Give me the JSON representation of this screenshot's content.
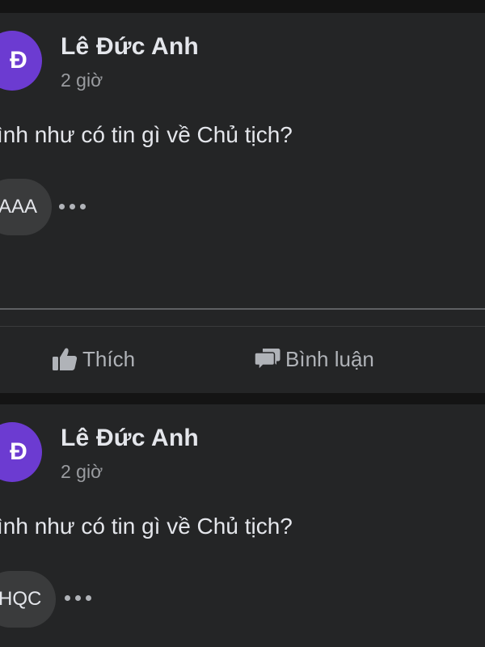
{
  "posts": [
    {
      "avatar_letter": "Đ",
      "avatar_color": "#6c3bd1",
      "author": "Lê Đức Anh",
      "time": "2 giờ",
      "text": "ình như có tin gì về Chủ tịch?",
      "reply_chip": "AAA",
      "more_icon": "more-horizontal-icon",
      "actions": {
        "like_label": "Thích",
        "like_icon": "thumbs-up-icon",
        "comment_label": "Bình luận",
        "comment_icon": "comment-icon"
      }
    },
    {
      "avatar_letter": "Đ",
      "avatar_color": "#6c3bd1",
      "author": "Lê Đức Anh",
      "time": "2 giờ",
      "text": "ình như có tin gì về Chủ tịch?",
      "reply_chip": "HQC",
      "more_icon": "more-horizontal-icon"
    }
  ],
  "colors": {
    "background": "#141414",
    "card": "#242526",
    "primary_text": "#e4e6eb",
    "secondary_text": "#b0b3b8",
    "chip": "#3a3b3c"
  }
}
